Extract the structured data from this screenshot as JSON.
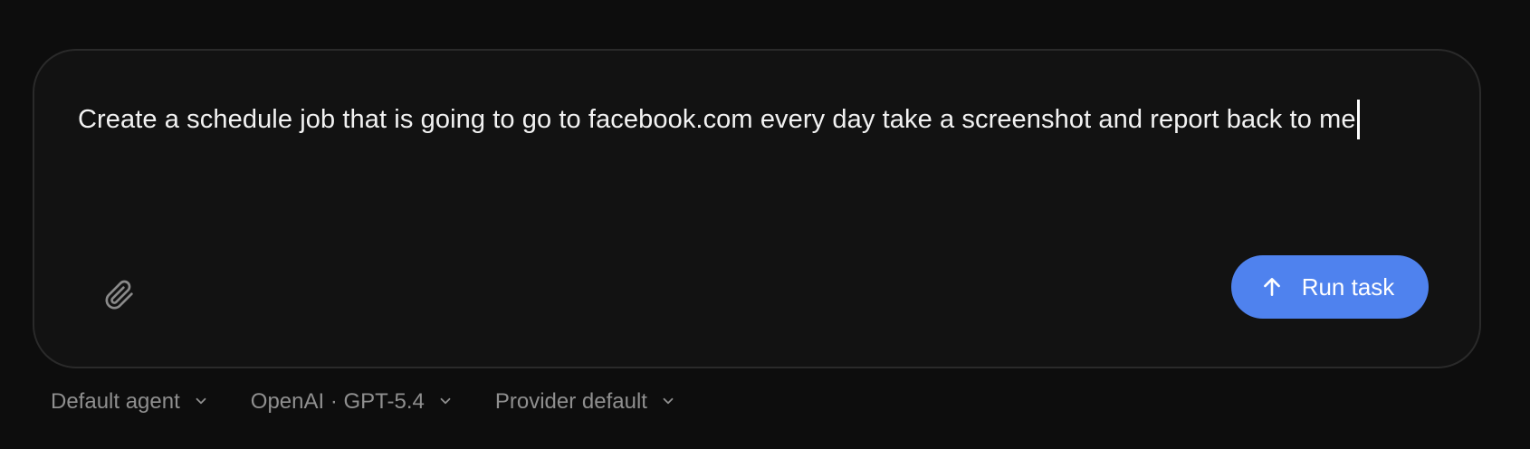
{
  "composer": {
    "prompt_text": "Create a schedule job that is going to go to facebook.com every day take a screenshot and report back to me",
    "attach_icon": "paperclip-icon",
    "run_button": {
      "label": "Run task",
      "icon": "arrow-up-icon",
      "color": "#4f82ee"
    }
  },
  "options": {
    "agent": "Default agent",
    "model": "OpenAI · GPT-5.4",
    "provider": "Provider default",
    "chevron_icon": "chevron-down-icon"
  },
  "colors": {
    "background": "#0d0d0d",
    "composer_background": "#121212",
    "composer_border": "#2a2a2a",
    "text": "#f2f2f2",
    "muted_text": "#8f8f8f"
  }
}
